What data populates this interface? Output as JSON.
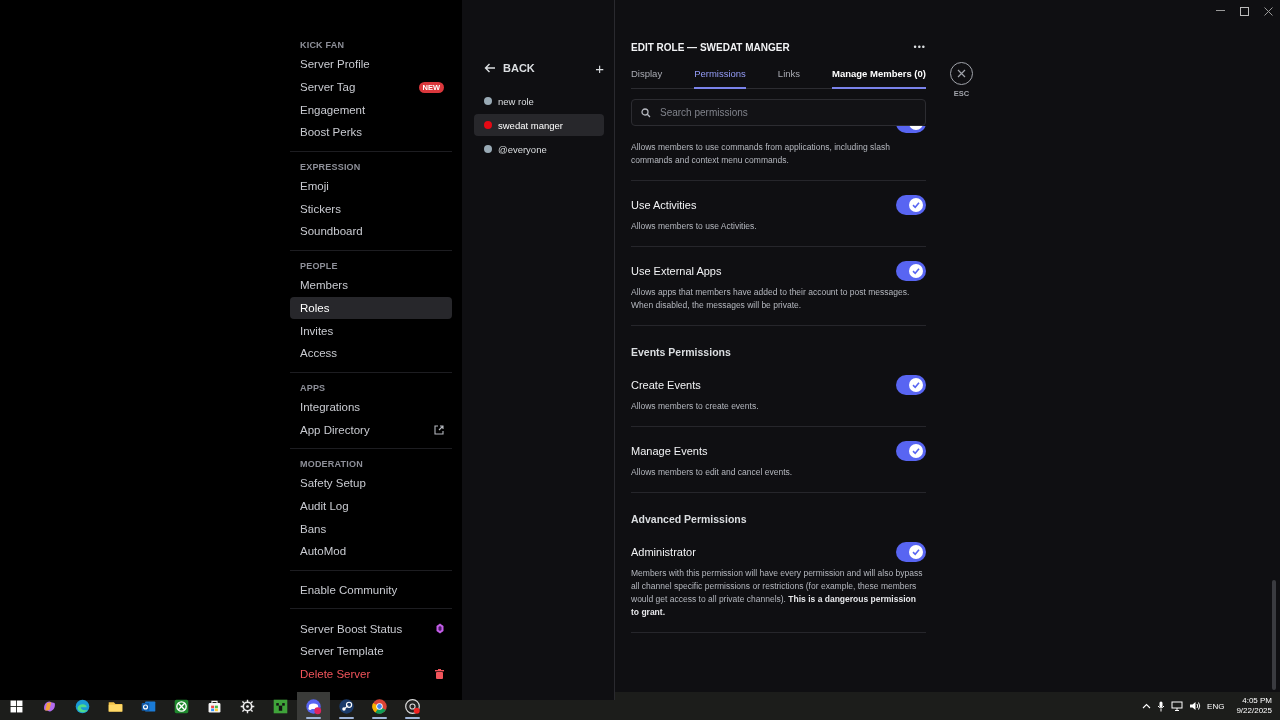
{
  "sidebar": {
    "groups": [
      {
        "header": "KICK FAN",
        "items": [
          {
            "kind": "plain",
            "label": "Server Profile",
            "selected": false
          },
          {
            "kind": "plain",
            "label": "Server Tag",
            "selected": false,
            "badge": "NEW"
          },
          {
            "kind": "plain",
            "label": "Engagement",
            "selected": false
          },
          {
            "kind": "plain",
            "label": "Boost Perks",
            "selected": false
          }
        ]
      },
      {
        "header": "EXPRESSION",
        "items": [
          {
            "kind": "plain",
            "label": "Emoji",
            "selected": false
          },
          {
            "kind": "plain",
            "label": "Stickers",
            "selected": false
          },
          {
            "kind": "plain",
            "label": "Soundboard",
            "selected": false
          }
        ]
      },
      {
        "header": "PEOPLE",
        "items": [
          {
            "kind": "plain",
            "label": "Members",
            "selected": false
          },
          {
            "kind": "plain",
            "label": "Roles",
            "selected": true
          },
          {
            "kind": "plain",
            "label": "Invites",
            "selected": false
          },
          {
            "kind": "plain",
            "label": "Access",
            "selected": false
          }
        ]
      },
      {
        "header": "APPS",
        "items": [
          {
            "kind": "plain",
            "label": "Integrations",
            "selected": false
          },
          {
            "kind": "external",
            "label": "App Directory",
            "selected": false
          }
        ]
      },
      {
        "header": "MODERATION",
        "items": [
          {
            "kind": "plain",
            "label": "Safety Setup",
            "selected": false
          },
          {
            "kind": "plain",
            "label": "Audit Log",
            "selected": false
          },
          {
            "kind": "plain",
            "label": "Bans",
            "selected": false
          },
          {
            "kind": "plain",
            "label": "AutoMod",
            "selected": false
          }
        ]
      },
      {
        "items": [
          {
            "kind": "plain",
            "label": "Enable Community",
            "selected": false
          }
        ]
      },
      {
        "items": [
          {
            "kind": "boost",
            "label": "Server Boost Status",
            "selected": false
          },
          {
            "kind": "plain",
            "label": "Server Template",
            "selected": false
          },
          {
            "kind": "delete",
            "label": "Delete Server",
            "selected": false
          }
        ]
      }
    ]
  },
  "roles": {
    "back": "BACK",
    "add": "+",
    "items": [
      {
        "name": "new role",
        "color": "#99aab5",
        "selected": false
      },
      {
        "name": "swedat manger",
        "color": "#e50914",
        "selected": true
      },
      {
        "name": "@everyone",
        "color": "#99aab5",
        "selected": false
      }
    ]
  },
  "editor": {
    "title": "EDIT ROLE — SWEDAT MANGER",
    "more": "•••",
    "tabs": [
      {
        "label": "Display",
        "selected": false,
        "hovered": false
      },
      {
        "label": "Permissions",
        "selected": true,
        "hovered": false
      },
      {
        "label": "Links",
        "selected": false,
        "hovered": false
      },
      {
        "label": "Manage Members (0)",
        "selected": false,
        "hovered": true
      }
    ],
    "search": {
      "placeholder": "Search permissions"
    },
    "close": {
      "label": "ESC"
    },
    "items": [
      {
        "kind": "cut",
        "on": true,
        "description": "Allows members to use commands from applications, including slash commands and context menu commands."
      },
      {
        "kind": "permission",
        "name": "Use Activities",
        "on": true,
        "description": "Allows members to use Activities."
      },
      {
        "kind": "permission",
        "name": "Use External Apps",
        "on": true,
        "description": "Allows apps that members have added to their account to post messages. When disabled, the messages will be private."
      },
      {
        "kind": "section",
        "name": "Events Permissions"
      },
      {
        "kind": "permission",
        "name": "Create Events",
        "on": true,
        "description": "Allows members to create events."
      },
      {
        "kind": "permission",
        "name": "Manage Events",
        "on": true,
        "description": "Allows members to edit and cancel events."
      },
      {
        "kind": "section",
        "name": "Advanced Permissions"
      },
      {
        "kind": "permission",
        "name": "Administrator",
        "on": true,
        "description": "Members with this permission will have every permission and will also bypass all channel specific permissions or restrictions (for example, these members would get access to all private channels). **This is a dangerous permission to grant.**"
      }
    ]
  },
  "taskbar": {
    "apps": [
      {
        "kind": "start",
        "active": false,
        "running": false
      },
      {
        "kind": "copilot",
        "active": false,
        "running": false
      },
      {
        "kind": "edge",
        "active": false,
        "running": false
      },
      {
        "kind": "folder",
        "active": false,
        "running": false
      },
      {
        "kind": "outlook",
        "active": false,
        "running": false
      },
      {
        "kind": "xbox",
        "active": false,
        "running": false
      },
      {
        "kind": "store",
        "active": false,
        "running": false
      },
      {
        "kind": "steelseries",
        "active": false,
        "running": false
      },
      {
        "kind": "minecraft",
        "active": false,
        "running": false
      },
      {
        "kind": "discord",
        "active": true,
        "running": true
      },
      {
        "kind": "steam",
        "active": false,
        "running": true
      },
      {
        "kind": "chrome",
        "active": false,
        "running": true
      },
      {
        "kind": "obs",
        "active": false,
        "running": true
      }
    ],
    "language": "ENG",
    "time": "4:05 PM",
    "date": "9/22/2025"
  }
}
